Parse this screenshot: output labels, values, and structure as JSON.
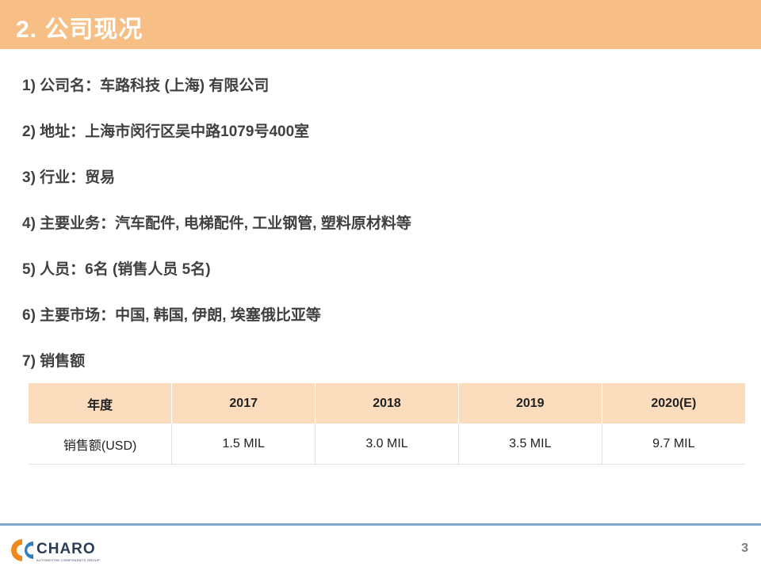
{
  "slide": {
    "title": "2. 公司现况",
    "items": [
      "1) 公司名：车路科技 (上海) 有限公司",
      "2) 地址：上海市闵行区吴中路1079号400室",
      "3) 行业：贸易",
      "4) 主要业务：汽车配件, 电梯配件, 工业钢管, 塑料原材料等",
      "5) 人员：6名 (销售人员 5名)",
      "6) 主要市场：中国, 韩国, 伊朗, 埃塞俄比亚等",
      "7) 销售额"
    ],
    "page_number": "3"
  },
  "sales_table": {
    "headers": [
      "年度",
      "2017",
      "2018",
      "2019",
      "2020(E)"
    ],
    "row": [
      "销售额(USD)",
      "1.5 MIL",
      "3.0 MIL",
      "3.5 MIL",
      "9.7 MIL"
    ]
  },
  "logo": {
    "name": "CHARO",
    "tagline": "AUTOMOTIVE COMPONENTS GROUP",
    "icon": "charo-logo-icon"
  },
  "colors": {
    "title_bar": "#f7bf86",
    "table_header": "#fbdcbc",
    "footer_line": "#7fa7c9",
    "logo_orange": "#f08a1c",
    "logo_blue": "#2f7ec1"
  }
}
